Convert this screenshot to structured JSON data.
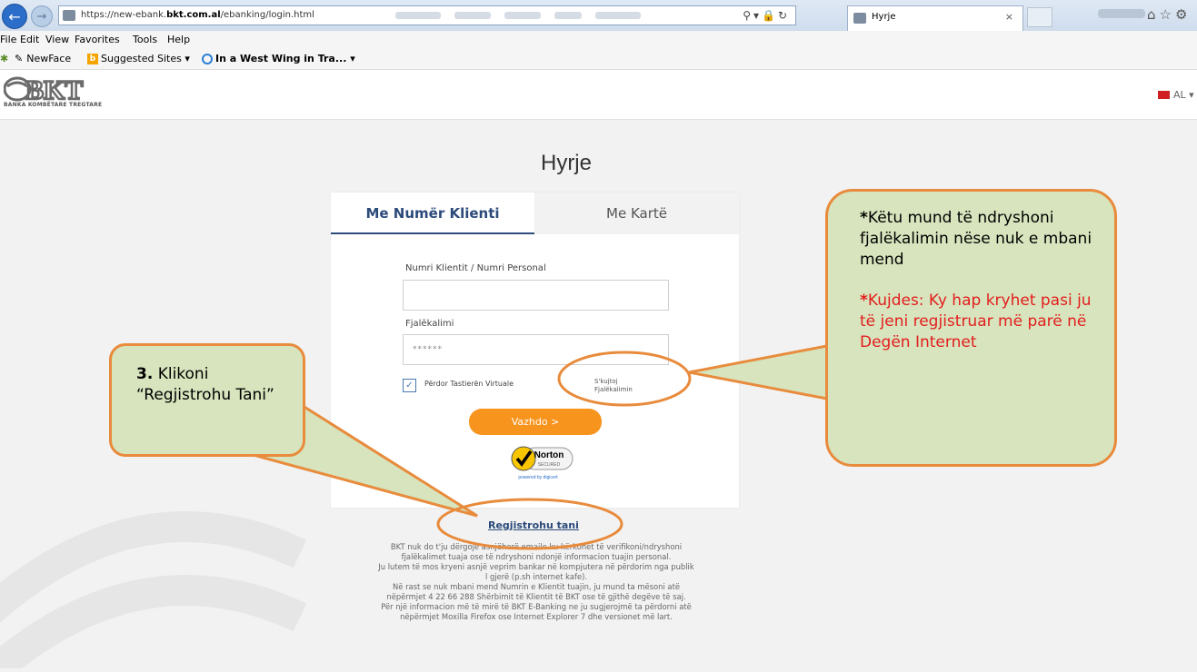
{
  "browser": {
    "url_prefix": "https://new-ebank.",
    "url_domain": "bkt.com.al",
    "url_path": "/ebanking/login.html",
    "tab_title": "Hyrje",
    "tab_close": "×",
    "menu": [
      "File",
      "Edit",
      "View",
      "Favorites",
      "Tools",
      "Help"
    ],
    "favorites": [
      "NewFace",
      "Suggested Sites ▾",
      "In a West Wing in Tra...  ▾"
    ]
  },
  "header": {
    "logo_text": "BKT",
    "logo_subtitle": "BANKA KOMBËTARE TREGTARE",
    "language": "AL ▾"
  },
  "login": {
    "title": "Hyrje",
    "tabs": [
      "Me Numër Klienti",
      "Me Kartë"
    ],
    "client_label": "Numri Klientit / Numri Personal",
    "client_value": "",
    "password_label": "Fjalëkalimi",
    "password_value": "******",
    "virtual_keyboard_label": "Përdor Tastierën Virtuale",
    "virtual_keyboard_checked": true,
    "forgot_line1": "S'kujtoj",
    "forgot_line2": "Fjalëkalimin",
    "continue_label": "Vazhdo >",
    "norton_label": "Norton",
    "norton_sub": "SECURED",
    "digicert": "powered by digicert",
    "register_label": "Regjistrohu tani",
    "disclaimer": [
      "BKT nuk do t'ju dërgojë asnjëherë emaile ku kërkohet të verifikoni/ndryshoni",
      "fjalëkalimet tuaja ose të ndryshoni ndonjë informacion tuajin personal.",
      "Ju lutem të mos kryeni asnjë veprim bankar në kompjutera në përdorim nga publik",
      "l gjerë (p.sh internet kafe).",
      "Në rast se nuk mbani mend Numrin e Klientit tuajin, ju mund ta mësoni atë",
      "nëpërmjet 4 22 66 288 Shërbimit të Klientit të BKT ose të gjithë degëve të saj.",
      "Për një informacion më të mirë të BKT E-Banking ne ju sugjerojmë ta përdorni atë",
      "nëpërmjet Moxilla Firefox ose Internet Explorer 7 dhe versionet më lart."
    ]
  },
  "callouts": {
    "left_number": "3.",
    "left_text": "Klikoni “Regjistrohu Tani”",
    "right_star1": "*",
    "right_text1": "Këtu mund të ndryshoni fjalëkalimin nëse nuk e mbani mend",
    "right_star2": "*",
    "right_text2": "Kujdes: Ky hap kryhet pasi ju të jeni regjistruar më parë në Degën Internet",
    "border_color": "#e88b3c",
    "fill_color": "#d7e4bd",
    "warning_color": "#e31e1e"
  }
}
